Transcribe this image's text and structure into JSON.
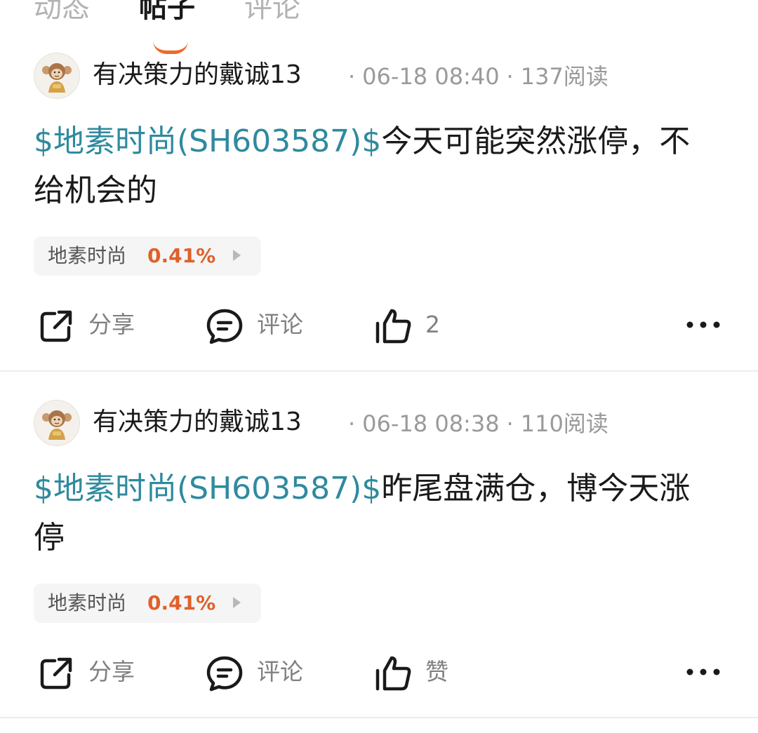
{
  "tabs": [
    {
      "label": "动态",
      "active": false
    },
    {
      "label": "帖子",
      "active": true
    },
    {
      "label": "评论",
      "active": false
    }
  ],
  "colors": {
    "accent": "#ef6a2c",
    "stock_link": "#2f8a9e",
    "change_up": "#e0602a",
    "muted_text": "#9a9a9a"
  },
  "posts": [
    {
      "author": "有决策力的戴诚13",
      "date": "06-18 08:40",
      "reads": "137阅读",
      "stock_tag": "$地素时尚(SH603587)$",
      "text": "今天可能突然涨停，不给机会的",
      "chip": {
        "name": "地素时尚",
        "change": "0.41%"
      },
      "actions": {
        "share": "分享",
        "comment": "评论",
        "like": "2"
      }
    },
    {
      "author": "有决策力的戴诚13",
      "date": "06-18 08:38",
      "reads": "110阅读",
      "stock_tag": "$地素时尚(SH603587)$",
      "text": "昨尾盘满仓，博今天涨停",
      "chip": {
        "name": "地素时尚",
        "change": "0.41%"
      },
      "actions": {
        "share": "分享",
        "comment": "评论",
        "like": "赞"
      }
    }
  ],
  "icons": {
    "avatar": "avatar-monkey-icon",
    "share": "share-icon",
    "comment": "comment-icon",
    "like": "thumbs-up-icon",
    "more": "more-dots-icon",
    "chip_arrow": "chevron-right-icon"
  }
}
